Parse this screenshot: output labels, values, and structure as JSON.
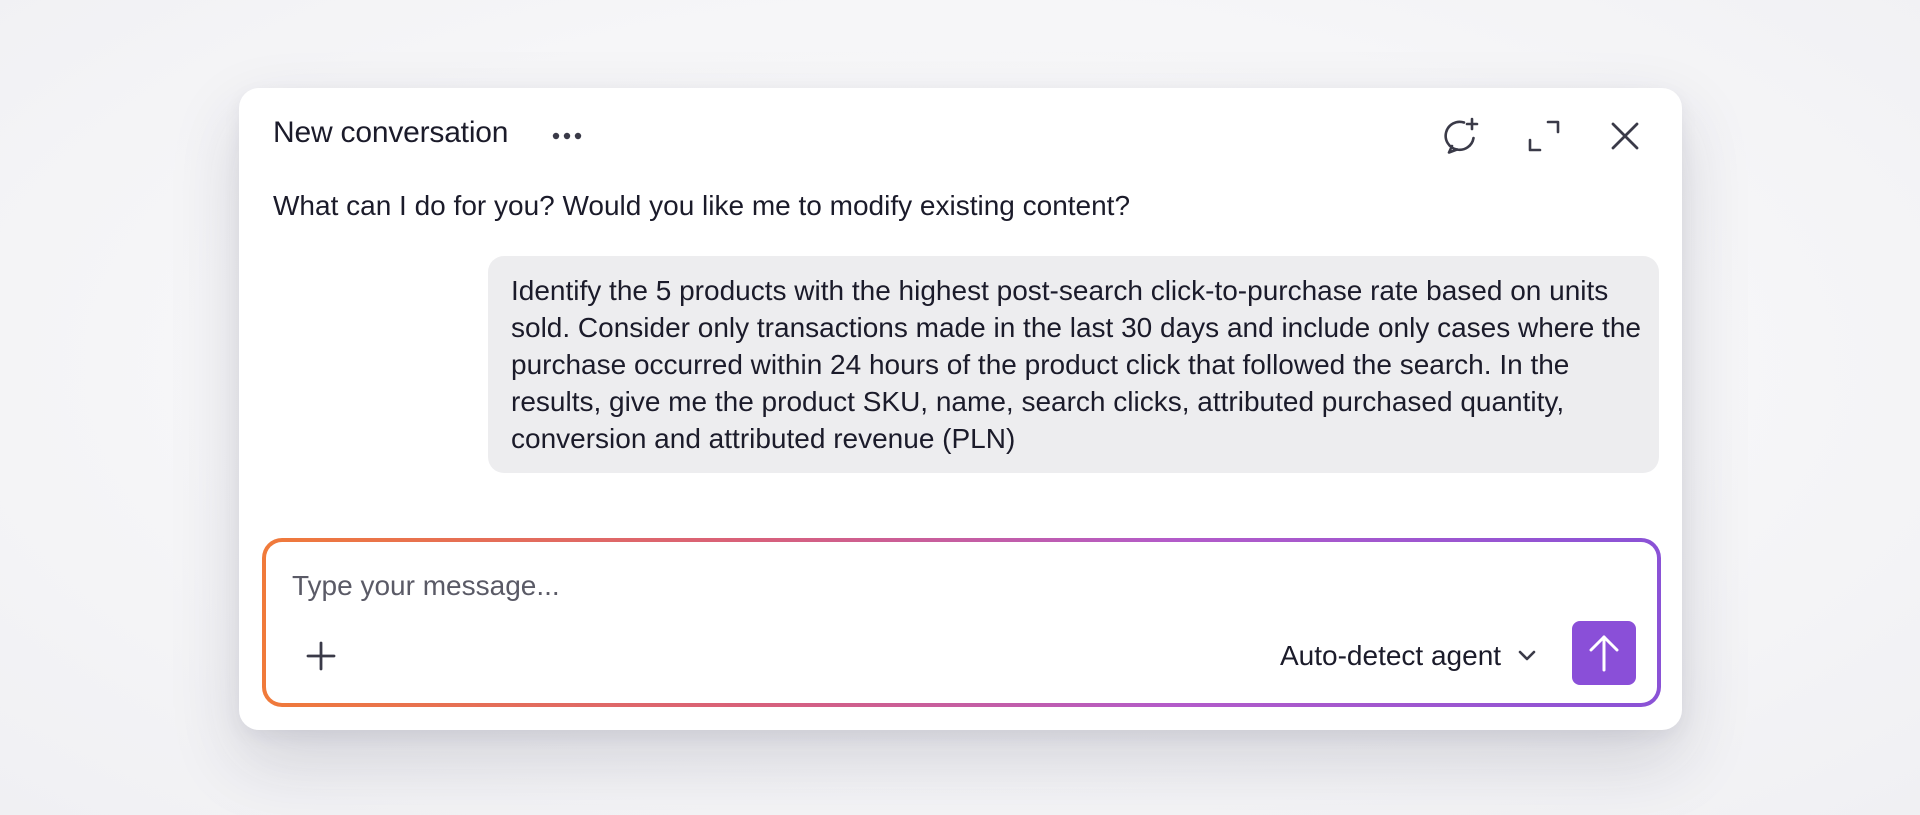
{
  "header": {
    "title": "New conversation",
    "more_icon": "more-horizontal-icon",
    "new_chat_icon": "chat-plus-icon",
    "expand_icon": "expand-icon",
    "close_icon": "close-icon"
  },
  "messages": [
    {
      "role": "assistant",
      "text": "What can I do for you? Would you like me to modify existing content?"
    },
    {
      "role": "user",
      "text": "Identify the 5 products with the highest post-search click-to-purchase rate based on units sold. Consider only transactions made in the last 30 days and include only cases where the purchase occurred within 24 hours of the product click that followed the search. In the results, give me the product SKU, name, search clicks, attributed purchased quantity, conversion and attributed revenue (PLN)"
    }
  ],
  "composer": {
    "placeholder": "Type your message...",
    "value": "",
    "attach_icon": "plus-icon",
    "agent_selected": "Auto-detect agent",
    "agent_chevron_icon": "chevron-down-icon",
    "send_icon": "arrow-up-icon"
  },
  "colors": {
    "accent": "#8a4fd8",
    "gradient_start": "#f07a3a",
    "gradient_end": "#8a52d6",
    "user_bubble": "#ededef",
    "text": "#1b1b2a"
  }
}
